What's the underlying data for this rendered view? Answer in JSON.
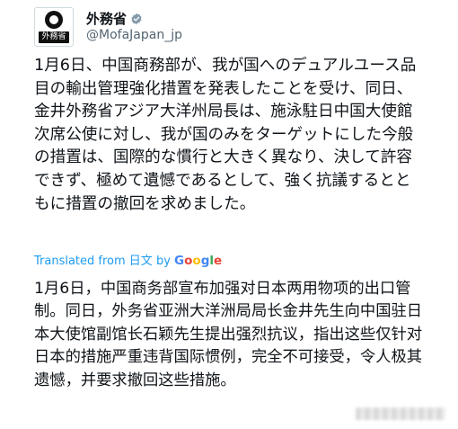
{
  "account": {
    "display_name": "外務省",
    "handle": "@MofaJapan_jp",
    "avatar_label": "外務省",
    "verified": true,
    "verified_icon": "verified-badge-icon",
    "badge_color": "#829aab"
  },
  "tweet": {
    "text": "1月6日、中国商務部が、我が国へのデュアルユース品目の輸出管理強化措置を発表したことを受け、同日、金井外務省アジア大洋州局長は、施泳駐日中国大使館次席公使に対し、我が国のみをターゲットにした今般の措置は、国際的な慣行と大きく異なり、決して許容できず、極めて遺憾であるとして、強く抗議するとともに措置の撤回を求めました。"
  },
  "translation": {
    "label_prefix": "Translated from ",
    "source_language": "日文",
    "label_by": " by ",
    "provider": "Google",
    "text": "1月6日，中国商务部宣布加强对日本两用物项的出口管制。同日，外务省亚洲大洋洲局局长金井先生向中国驻日本大使馆副馆长石颖先生提出强烈抗议，指出这些仅针对日本的措施严重违背国际惯例，完全不可接受，令人极其遗憾，并要求撤回这些措施。",
    "link_color": "#1d9bf0"
  }
}
